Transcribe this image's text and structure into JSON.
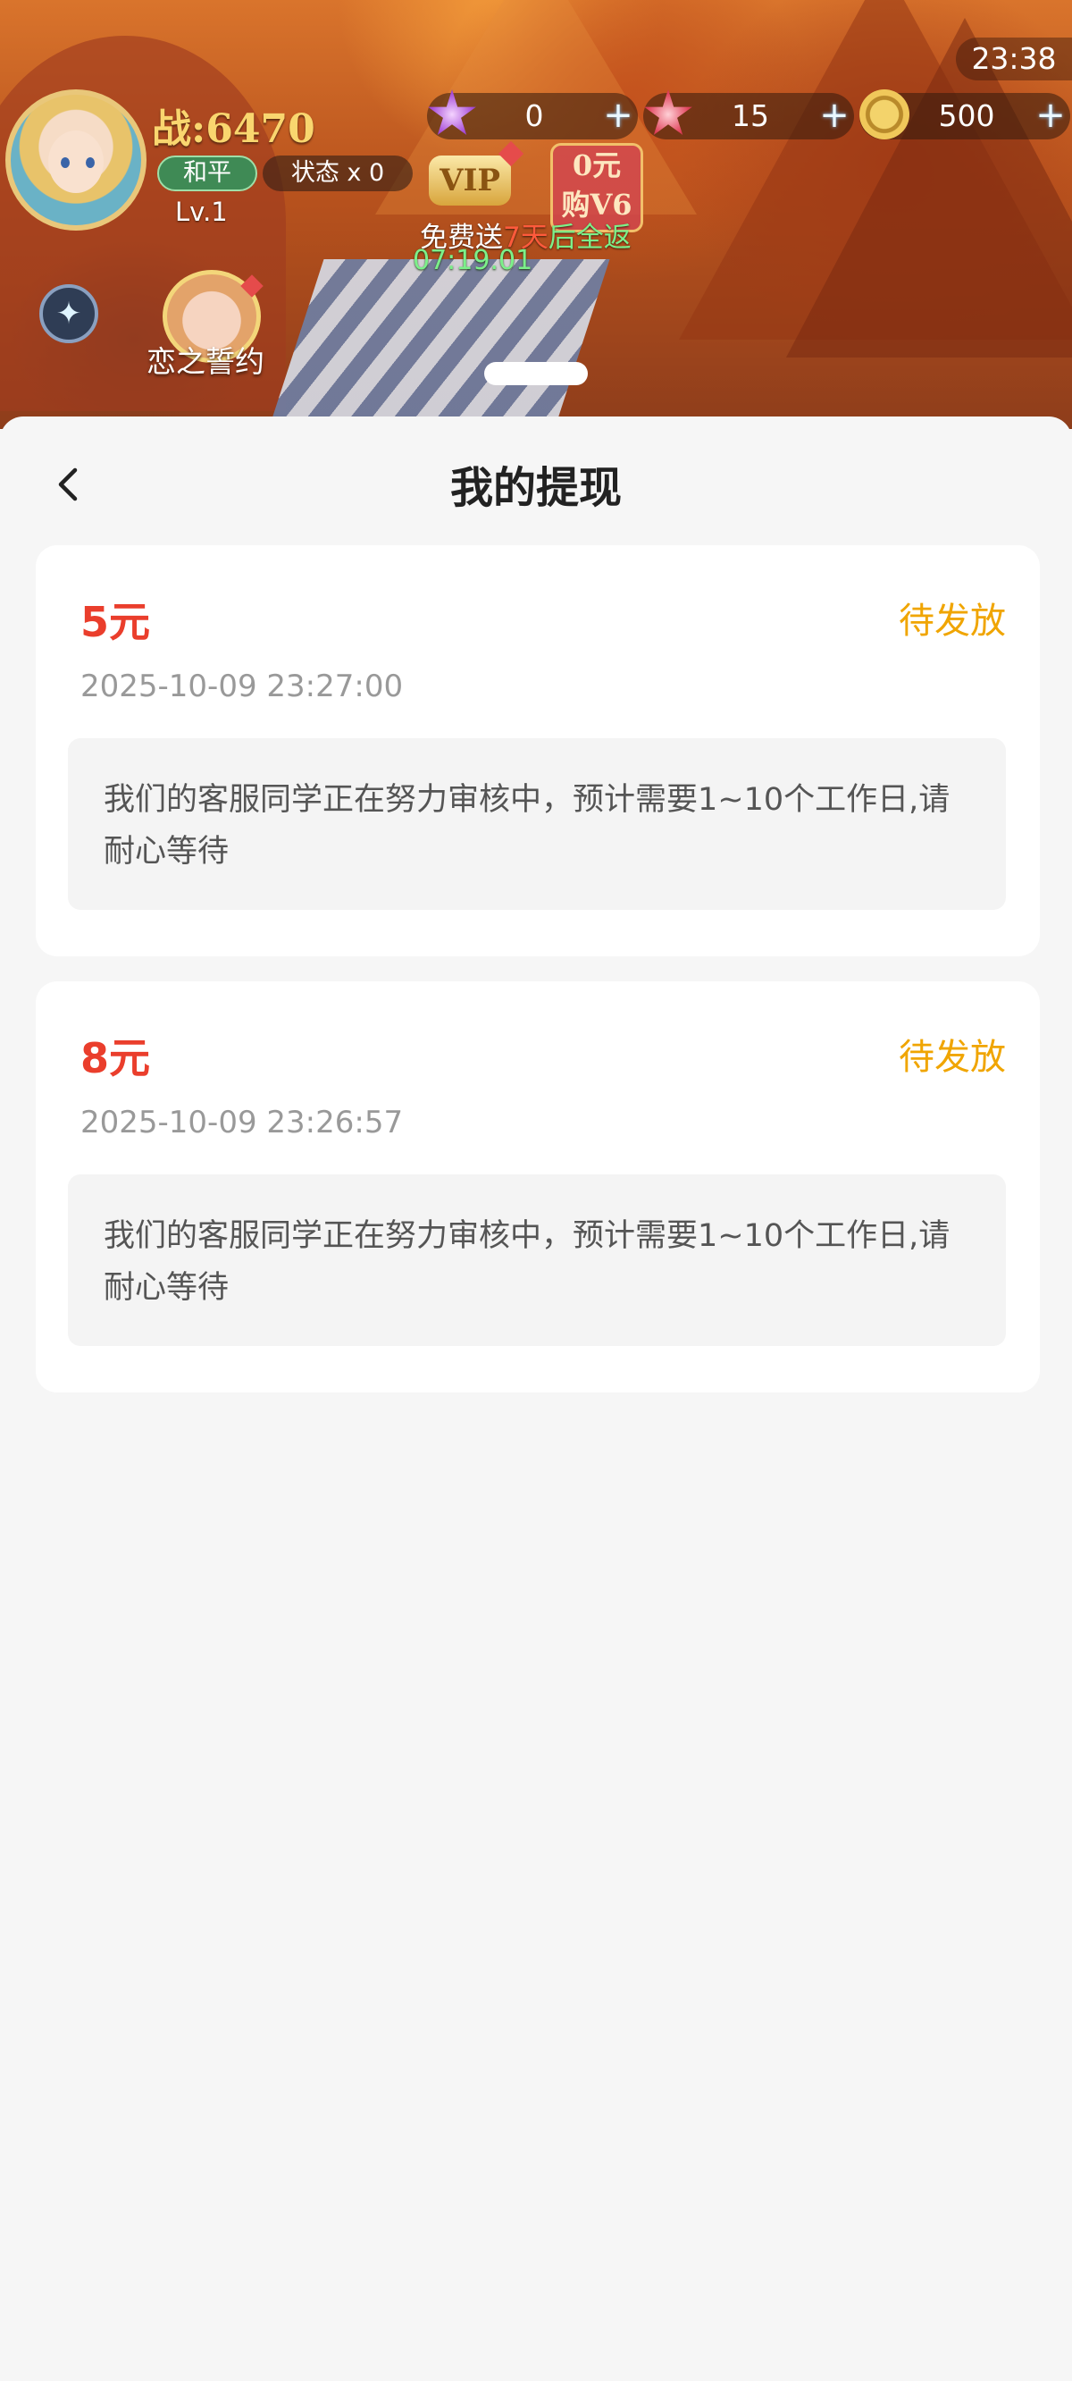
{
  "game_hud": {
    "clock": "23:38",
    "combat_power": "战:6470",
    "peace_badge": "和平",
    "status_label": "状态 x 0",
    "level": "Lv.1",
    "resources": [
      {
        "icon": "purple-star-icon",
        "value": "0"
      },
      {
        "icon": "red-star-icon",
        "value": "15"
      },
      {
        "icon": "gold-coin-icon",
        "value": "500"
      }
    ],
    "vip_badge": "VIP",
    "v6_line1": "0元",
    "v6_line2": "购V6",
    "free_send_prefix": "免费送",
    "free_send_days": "7天",
    "free_send_suffix": "后全返",
    "countdown": "07:19.01",
    "love_vow_label": "恋之誓约"
  },
  "page": {
    "title": "我的提现"
  },
  "withdrawals": [
    {
      "amount": "5元",
      "status": "待发放",
      "time": "2025-10-09 23:27:00",
      "message": "我们的客服同学正在努力审核中，预计需要1~10个工作日,请耐心等待"
    },
    {
      "amount": "8元",
      "status": "待发放",
      "time": "2025-10-09 23:26:57",
      "message": "我们的客服同学正在努力审核中，预计需要1~10个工作日,请耐心等待"
    }
  ],
  "colors": {
    "amount": "#ea3e2c",
    "status": "#f0a500",
    "page_bg": "#f6f6f6"
  }
}
